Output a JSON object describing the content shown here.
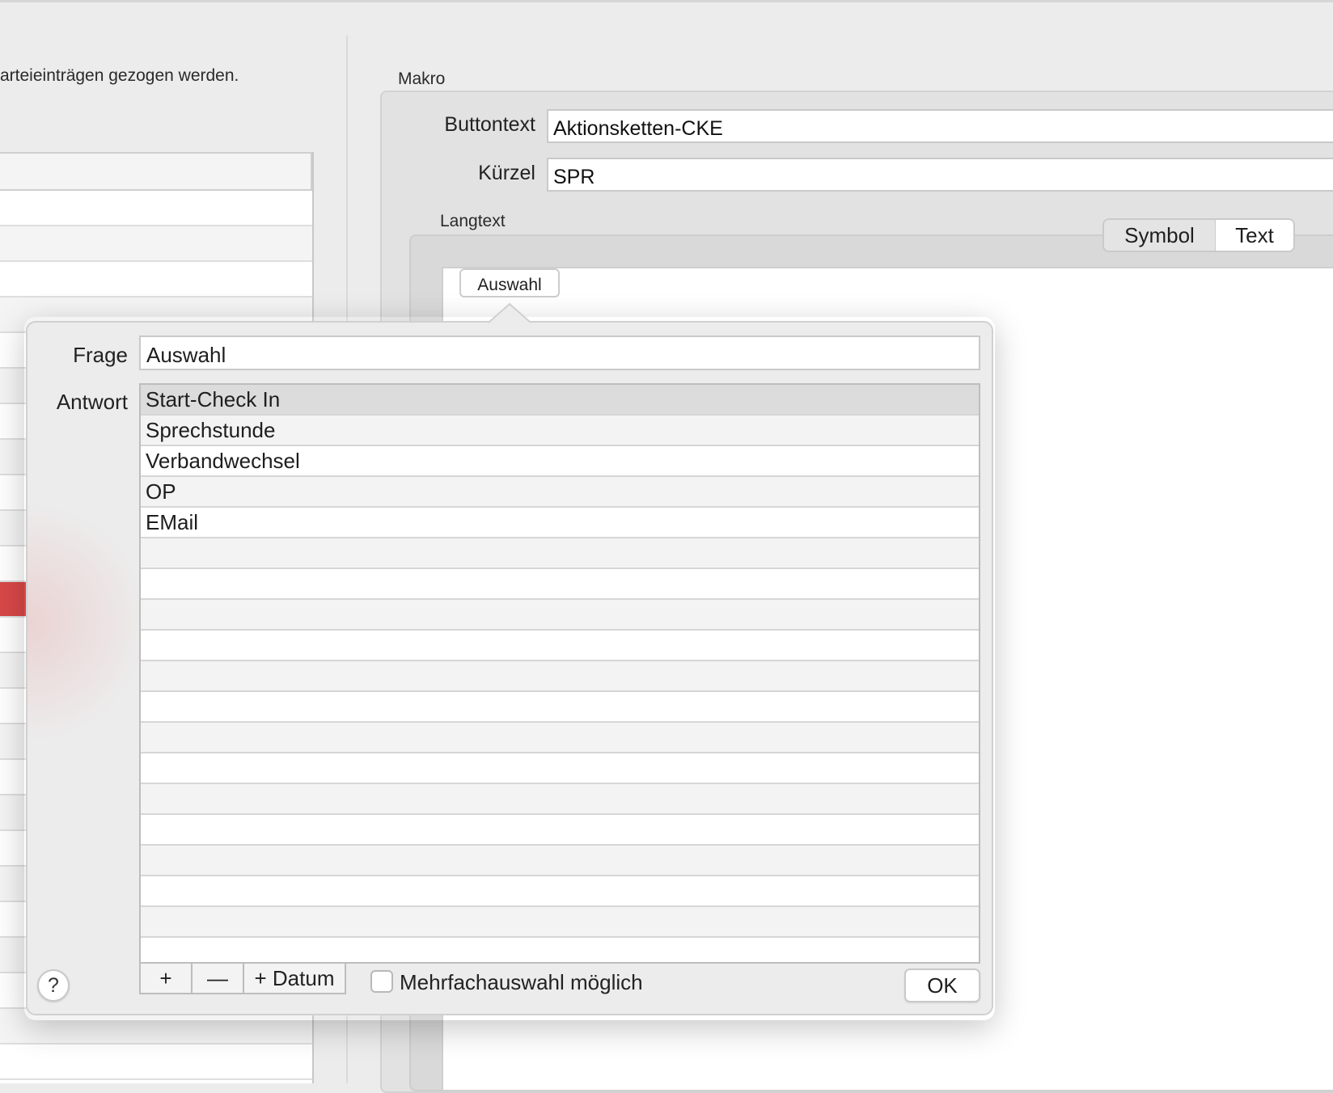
{
  "left_panel": {
    "description_fragment": "arteieinträgen gezogen werden."
  },
  "makro": {
    "group_label": "Makro",
    "buttontext_label": "Buttontext",
    "buttontext_value": "Aktionsketten-CKE",
    "kuerzel_label": "Kürzel",
    "kuerzel_value": "SPR",
    "langtext_label": "Langtext",
    "segment_options": [
      "Symbol",
      "Text"
    ],
    "selected_segment": "Text",
    "token_label": "Auswahl"
  },
  "popover": {
    "frage_label": "Frage",
    "frage_value": "Auswahl",
    "antwort_label": "Antwort",
    "answers": [
      "Start-Check In",
      "Sprechstunde",
      "Verbandwechsel",
      "OP",
      "EMail"
    ],
    "selected_answer": "Start-Check In",
    "add_label": "+",
    "remove_label": "—",
    "add_date_label": "+ Datum",
    "multi_select_label": "Mehrfachauswahl möglich",
    "multi_select_checked": false,
    "ok_label": "OK",
    "help_label": "?"
  },
  "colors": {
    "selected_row_left": "#d84848",
    "window_bg": "#ececec"
  }
}
